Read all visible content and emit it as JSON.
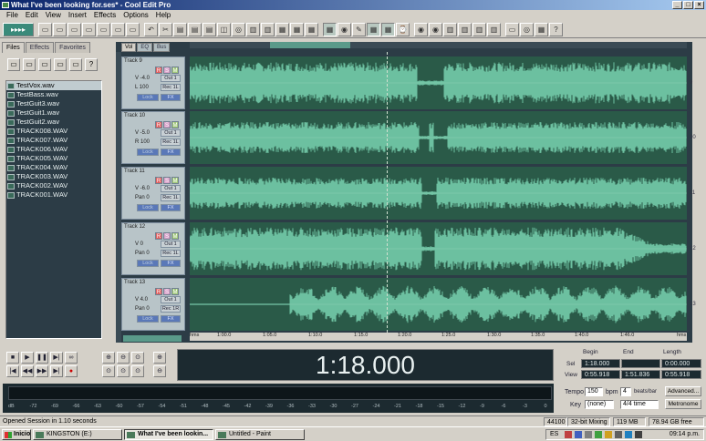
{
  "window": {
    "title": "What I've been looking for.ses* - Cool Edit Pro"
  },
  "menu": [
    "File",
    "Edit",
    "View",
    "Insert",
    "Effects",
    "Options",
    "Help"
  ],
  "left_panel": {
    "tabs": [
      "Files",
      "Effects",
      "Favorites"
    ],
    "files": [
      "TestVox.wav",
      "TestBass.wav",
      "TestGuit3.wav",
      "TestGuit1.wav",
      "TestGuit2.wav",
      "TRACK008.WAV",
      "TRACK007.WAV",
      "TRACK006.WAV",
      "TRACK005.WAV",
      "TRACK004.WAV",
      "TRACK003.WAV",
      "TRACK002.WAV",
      "TRACK001.WAV"
    ]
  },
  "view_tabs": [
    "Vol",
    "EQ",
    "Bus"
  ],
  "tracks": [
    {
      "name": "Track 9",
      "vol": "V -4.0",
      "pan": "L 100",
      "num": "9",
      "out": "Out 1",
      "rec": "Rec 1L"
    },
    {
      "name": "Track 10",
      "vol": "V -5.0",
      "pan": "R 100",
      "num": "10",
      "out": "Out 1",
      "rec": "Rec 1L"
    },
    {
      "name": "Track 11",
      "vol": "V -6.0",
      "pan": "Pan 0",
      "num": "11",
      "out": "Out 1",
      "rec": "Rec 1L"
    },
    {
      "name": "Track 12",
      "vol": "V 0",
      "pan": "Pan 0",
      "num": "12",
      "out": "Out 1",
      "rec": "Rec 1L"
    },
    {
      "name": "Track 13",
      "vol": "V 4.0",
      "pan": "Pan 0",
      "num": "13",
      "out": "Out 1",
      "rec": "Rec 1R"
    }
  ],
  "track_buttons": {
    "r": "R",
    "s": "S",
    "m": "M",
    "lock": "Lock",
    "fx": "FX"
  },
  "ruler": {
    "unit": "hms",
    "ticks": [
      "1:00.0",
      "1:05.0",
      "1:10.0",
      "1:15.0",
      "1:20.0",
      "1:25.0",
      "1:30.0",
      "1:35.0",
      "1:40.0",
      "1:46.0"
    ]
  },
  "time_display": "1:18.000",
  "time_info": {
    "headers": [
      "Begin",
      "End",
      "Length"
    ],
    "sel_label": "Sel",
    "view_label": "View",
    "sel": [
      "1:18.000",
      "",
      "0:00.000"
    ],
    "view": [
      "0:55.918",
      "1:51.836",
      "0:55.918"
    ]
  },
  "meter_labels": [
    "dB",
    "-72",
    "-69",
    "-66",
    "-63",
    "-60",
    "-57",
    "-54",
    "-51",
    "-48",
    "-45",
    "-42",
    "-39",
    "-36",
    "-33",
    "-30",
    "-27",
    "-24",
    "-21",
    "-18",
    "-15",
    "-12",
    "-9",
    "-6",
    "-3",
    "0"
  ],
  "tempo": {
    "tempo_label": "Tempo",
    "tempo_value": "150",
    "bpm": "bpm",
    "beats_value": "4",
    "beats_label": "beats/bar",
    "advanced": "Advanced...",
    "key_label": "Key",
    "key_value": "(none)",
    "time_sig": "4/4 time",
    "metronome": "Metronome"
  },
  "status": {
    "message": "Opened Session in 1.10 seconds",
    "rate": "44100",
    "mixing": "32-bit Mixing",
    "mem": "119 MB",
    "free": "78.94 GB free"
  },
  "taskbar": {
    "start": "Inicio",
    "items": [
      "KINGSTON (E:)",
      "What I've been lookin...",
      "Untitled - Paint"
    ],
    "lang": "ES",
    "clock": "09:14 p.m."
  }
}
